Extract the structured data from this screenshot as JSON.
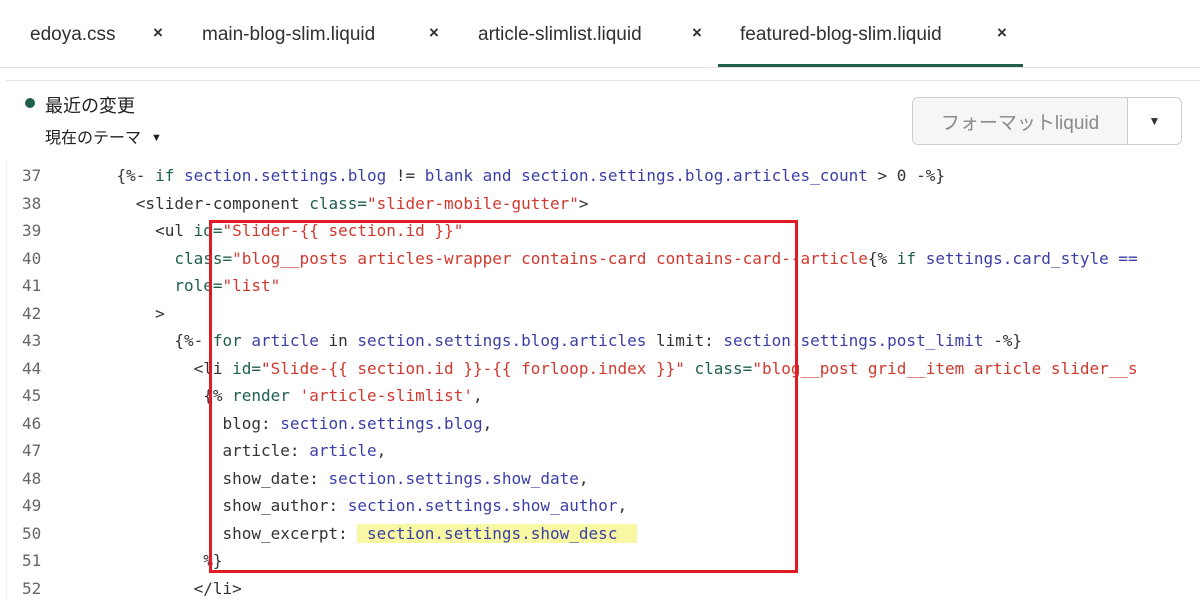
{
  "tabs": [
    {
      "label": "edoya.css",
      "close": "×",
      "active": false
    },
    {
      "label": "main-blog-slim.liquid",
      "close": "×",
      "active": false
    },
    {
      "label": "article-slimlist.liquid",
      "close": "×",
      "active": false
    },
    {
      "label": "featured-blog-slim.liquid",
      "close": "×",
      "active": true
    }
  ],
  "toolbar": {
    "status_title": "最近の変更",
    "theme_select": "現在のテーマ",
    "format_button": "フォーマットliquid",
    "dropdown_icon": "caret-down-icon"
  },
  "editor": {
    "line_numbers": [
      "37",
      "38",
      "39",
      "40",
      "41",
      "42",
      "43",
      "44",
      "45",
      "46",
      "47",
      "48",
      "49",
      "50",
      "51",
      "52"
    ],
    "lines": [
      {
        "indent": "    ",
        "tokens": [
          {
            "t": "{%- ",
            "c": "plain"
          },
          {
            "t": "if ",
            "c": "kw"
          },
          {
            "t": "section.settings.blog",
            "c": "var"
          },
          {
            "t": " != ",
            "c": "plain"
          },
          {
            "t": "blank and ",
            "c": "var"
          },
          {
            "t": "section.settings.blog.articles_count",
            "c": "var"
          },
          {
            "t": " > 0 -%}",
            "c": "plain"
          }
        ]
      },
      {
        "indent": "      ",
        "tokens": [
          {
            "t": "<slider-component ",
            "c": "plain"
          },
          {
            "t": "class=",
            "c": "kw"
          },
          {
            "t": "\"slider-mobile-gutter\"",
            "c": "str"
          },
          {
            "t": ">",
            "c": "plain"
          }
        ]
      },
      {
        "indent": "        ",
        "tokens": [
          {
            "t": "<ul ",
            "c": "plain"
          },
          {
            "t": "id=",
            "c": "kw"
          },
          {
            "t": "\"Slider-{{ section.id }}\"",
            "c": "str"
          }
        ]
      },
      {
        "indent": "          ",
        "tokens": [
          {
            "t": "class=",
            "c": "kw"
          },
          {
            "t": "\"blog__posts articles-wrapper contains-card contains-card--article",
            "c": "str"
          },
          {
            "t": "{% ",
            "c": "plain"
          },
          {
            "t": "if ",
            "c": "kw"
          },
          {
            "t": "settings.card_style ==",
            "c": "var"
          }
        ]
      },
      {
        "indent": "          ",
        "tokens": [
          {
            "t": "role=",
            "c": "kw"
          },
          {
            "t": "\"list\"",
            "c": "str"
          }
        ]
      },
      {
        "indent": "        ",
        "tokens": [
          {
            "t": ">",
            "c": "plain"
          }
        ]
      },
      {
        "indent": "          ",
        "tokens": [
          {
            "t": "{%- ",
            "c": "plain"
          },
          {
            "t": "for ",
            "c": "kw"
          },
          {
            "t": "article",
            "c": "var"
          },
          {
            "t": " in ",
            "c": "plain"
          },
          {
            "t": "section.settings.blog.articles",
            "c": "var"
          },
          {
            "t": " limit: ",
            "c": "plain"
          },
          {
            "t": "section.settings.post_limit",
            "c": "var"
          },
          {
            "t": " -%}",
            "c": "plain"
          }
        ]
      },
      {
        "indent": "            ",
        "tokens": [
          {
            "t": "<li ",
            "c": "plain"
          },
          {
            "t": "id=",
            "c": "kw"
          },
          {
            "t": "\"Slide-{{ section.id }}-{{ forloop.index }}\"",
            "c": "str"
          },
          {
            "t": " class=",
            "c": "kw"
          },
          {
            "t": "\"blog__post grid__item article slider__s",
            "c": "str"
          }
        ]
      },
      {
        "indent": "             ",
        "tokens": [
          {
            "t": "{% ",
            "c": "plain"
          },
          {
            "t": "render ",
            "c": "kw"
          },
          {
            "t": "'article-slimlist'",
            "c": "str"
          },
          {
            "t": ",",
            "c": "plain"
          }
        ]
      },
      {
        "indent": "               ",
        "tokens": [
          {
            "t": "blog: ",
            "c": "plain"
          },
          {
            "t": "section.settings.blog",
            "c": "var"
          },
          {
            "t": ",",
            "c": "plain"
          }
        ]
      },
      {
        "indent": "               ",
        "tokens": [
          {
            "t": "article: ",
            "c": "plain"
          },
          {
            "t": "article",
            "c": "var"
          },
          {
            "t": ",",
            "c": "plain"
          }
        ]
      },
      {
        "indent": "               ",
        "tokens": [
          {
            "t": "show_date: ",
            "c": "plain"
          },
          {
            "t": "section.settings.show_date",
            "c": "var"
          },
          {
            "t": ",",
            "c": "plain"
          }
        ]
      },
      {
        "indent": "               ",
        "tokens": [
          {
            "t": "show_author: ",
            "c": "plain"
          },
          {
            "t": "section.settings.show_author",
            "c": "var"
          },
          {
            "t": ",",
            "c": "plain"
          }
        ]
      },
      {
        "indent": "               ",
        "tokens": [
          {
            "t": "show_excerpt: ",
            "c": "plain"
          },
          {
            "t": " section.settings.show_desc  ",
            "c": "hl"
          }
        ]
      },
      {
        "indent": "             ",
        "tokens": [
          {
            "t": "%}",
            "c": "plain"
          }
        ]
      },
      {
        "indent": "            ",
        "tokens": [
          {
            "t": "</li>",
            "c": "plain"
          }
        ]
      }
    ]
  },
  "colors": {
    "accent": "#1f5f4d",
    "keyword": "#1f5f4d",
    "variable": "#3b3fa5",
    "string": "#d0392f",
    "highlight": "#f8f7a3",
    "annotation_box": "#e01b24"
  }
}
